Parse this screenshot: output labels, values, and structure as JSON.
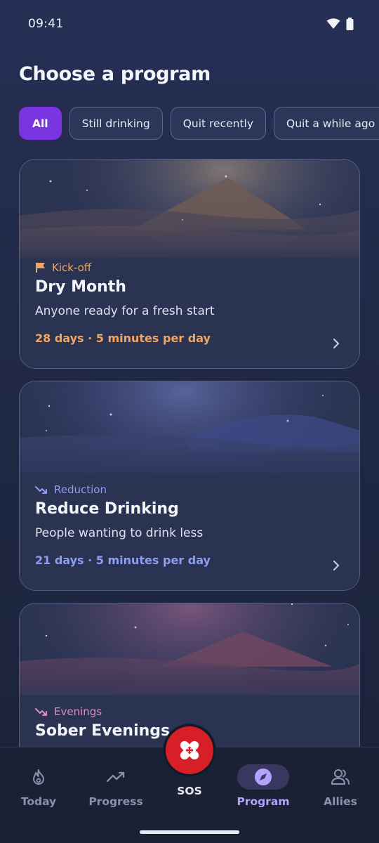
{
  "status_bar": {
    "time": "09:41",
    "icons": [
      "wifi-icon",
      "battery-icon"
    ]
  },
  "page": {
    "title": "Choose a program"
  },
  "filters": [
    {
      "label": "All",
      "active": true
    },
    {
      "label": "Still drinking",
      "active": false
    },
    {
      "label": "Quit recently",
      "active": false
    },
    {
      "label": "Quit a while ago",
      "active": false
    }
  ],
  "cards": [
    {
      "tag": "Kick-off",
      "tag_icon": "flag-icon",
      "title": "Dry Month",
      "subtitle": "Anyone ready for a fresh start",
      "meta": "28 days · 5 minutes per day",
      "accent": "#f0a765"
    },
    {
      "tag": "Reduction",
      "tag_icon": "trending-down-icon",
      "title": "Reduce Drinking",
      "subtitle": "People wanting to drink less",
      "meta": "21 days · 5 minutes per day",
      "accent": "#8f9ff0"
    },
    {
      "tag": "Evenings",
      "tag_icon": "trending-down-icon",
      "title": "Sober Evenings",
      "subtitle": "",
      "meta": "",
      "accent": "#e18bc3"
    }
  ],
  "nav": {
    "today": "Today",
    "progress": "Progress",
    "sos": "SOS",
    "program": "Program",
    "allies": "Allies",
    "active": "program"
  },
  "colors": {
    "active_chip": "#7a35e0",
    "sos": "#d61f26",
    "active_nav": "#b2a3ff"
  }
}
